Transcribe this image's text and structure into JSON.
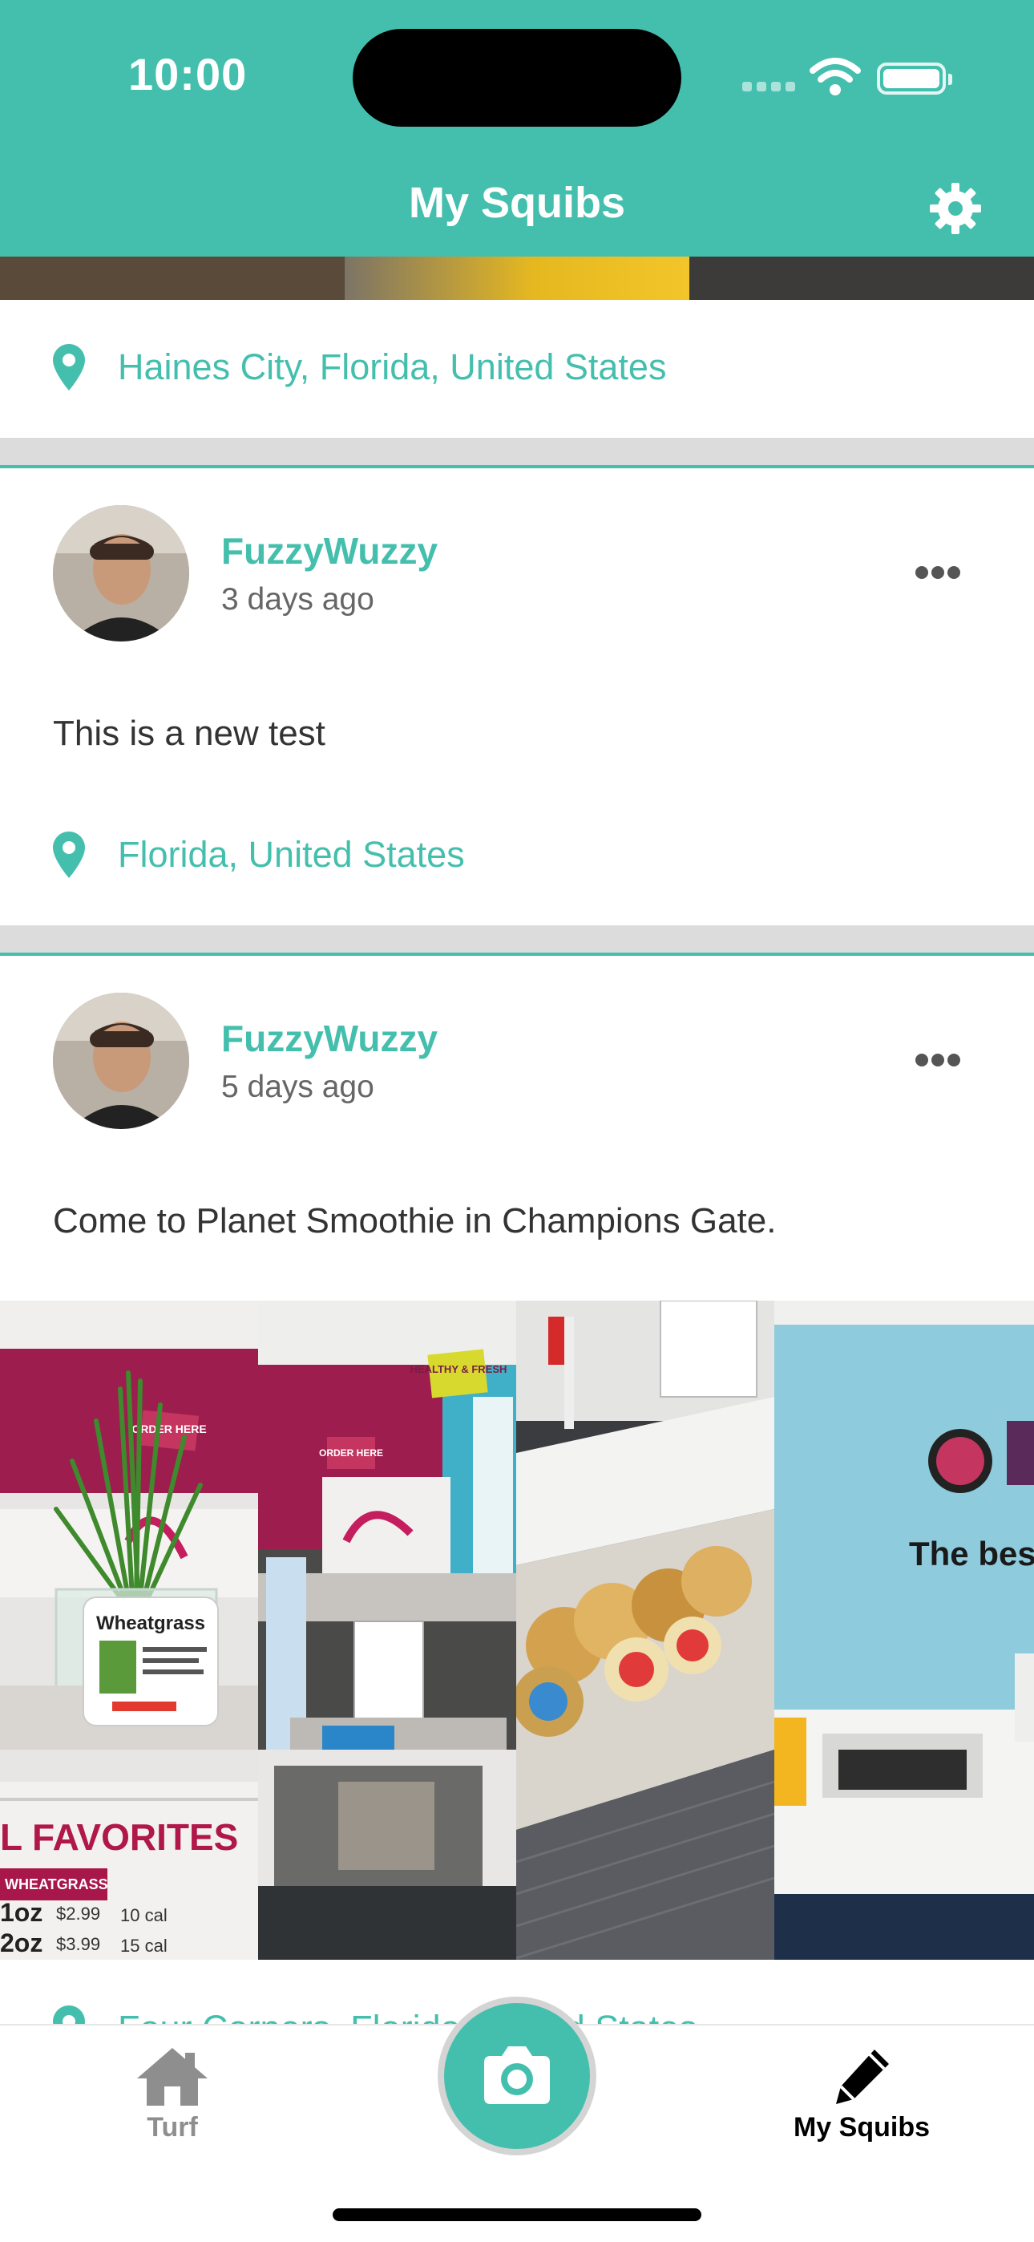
{
  "status_bar": {
    "time": "10:00"
  },
  "header": {
    "title": "My Squibs",
    "settings_icon": "gear-icon"
  },
  "feed": {
    "partial_post": {
      "location": "Haines City, Florida, United States"
    },
    "posts": [
      {
        "username": "FuzzyWuzzy",
        "time_ago": "3 days ago",
        "text": "This is a new test",
        "location": "Florida, United States"
      },
      {
        "username": "FuzzyWuzzy",
        "time_ago": "5 days ago",
        "text": "Come to Planet Smoothie in Champions Gate.",
        "location": "Four Corners, Florida, United States",
        "photos": [
          {
            "sign_title": "Wheatgrass",
            "banner": "L FAVORITES",
            "menu_item": "WHEATGRASS",
            "row1_size": "1oz",
            "row1_price": "$2.99",
            "row1_cal": "10 cal",
            "row2_size": "2oz",
            "row2_price": "$3.99",
            "row2_cal": "15 cal",
            "wall_sign": "ORDER HERE"
          },
          {
            "wall_sign": "ORDER HERE",
            "tag": "HEALTHY & FRESH"
          },
          {},
          {
            "wall_text": "The best"
          }
        ]
      }
    ]
  },
  "tabbar": {
    "tabs": [
      {
        "label": "Turf",
        "icon": "home-icon"
      },
      {
        "label": "My Squibs",
        "icon": "pencil-icon"
      }
    ],
    "camera_icon": "camera-icon"
  },
  "colors": {
    "accent": "#45bfad",
    "active_tab": "#000000",
    "inactive_tab": "#8e8e8e"
  }
}
